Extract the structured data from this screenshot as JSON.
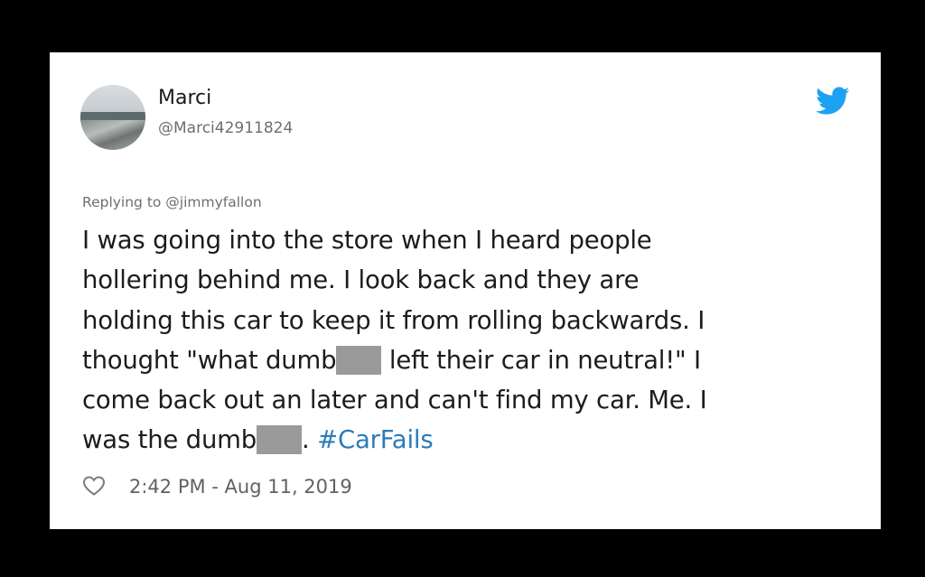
{
  "user": {
    "display_name": "Marci",
    "handle": "@Marci42911824"
  },
  "reply": {
    "label": "Replying to @jimmyfallon"
  },
  "tweet": {
    "line1": "I was going into the store when I heard people",
    "line2": "hollering behind me. I look back and they are",
    "line3": "holding this car to keep it from rolling backwards. I",
    "line4_a": "thought \"what dumb",
    "line4_b": " left their car in neutral!\" I",
    "line5": "come back out an later and can't find my car. Me. I",
    "line6_a": "was the dumb",
    "line6_b": ". ",
    "hashtag": "#CarFails"
  },
  "meta": {
    "timestamp": "2:42 PM - Aug 11, 2019"
  },
  "icons": {
    "brand": "twitter-bird-icon",
    "like": "heart-icon"
  },
  "colors": {
    "brand": "#1da1f2",
    "hashtag": "#2b7bb9",
    "background": "#000000",
    "card": "#ffffff"
  }
}
